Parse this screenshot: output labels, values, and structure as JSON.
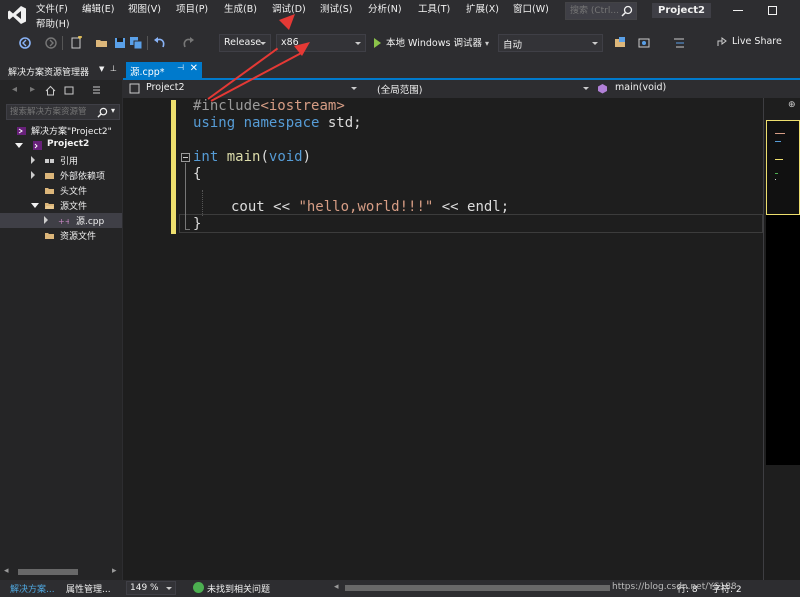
{
  "menu": {
    "items": [
      "文件(F)",
      "编辑(E)",
      "视图(V)",
      "项目(P)",
      "生成(B)",
      "调试(D)",
      "测试(S)",
      "分析(N)",
      "工具(T)",
      "扩展(X)",
      "窗口(W)"
    ],
    "help": "帮助(H)",
    "search_placeholder": "搜索 (Ctrl...",
    "project_title": "Project2"
  },
  "toolbar": {
    "configuration": "Release",
    "platform": "x86",
    "run_label": "本地 Windows 调试器",
    "auto_label": "自动",
    "live_share": "Live Share"
  },
  "solution_explorer": {
    "title": "解决方案资源管理器",
    "search_placeholder": "搜索解决方案资源管",
    "tree": [
      {
        "label": "解决方案\"Project2\"",
        "icon": "solution-icon"
      },
      {
        "label": "Project2",
        "icon": "project-icon"
      },
      {
        "label": "引用",
        "icon": "references-icon"
      },
      {
        "label": "外部依赖项",
        "icon": "dependencies-icon"
      },
      {
        "label": "头文件",
        "icon": "folder-icon"
      },
      {
        "label": "源文件",
        "icon": "folder-open-icon"
      },
      {
        "label": "源.cpp",
        "icon": "cpp-file-icon"
      },
      {
        "label": "资源文件",
        "icon": "folder-icon"
      }
    ]
  },
  "editor": {
    "tab_label": "源.cpp*",
    "nav_project": "Project2",
    "nav_scope": "(全局范围)",
    "nav_member": "main(void)",
    "code": {
      "include_directive": "#include",
      "include_open": "<",
      "include_header": "iostream",
      "include_close": ">",
      "using_kw": "using",
      "namespace_kw": "namespace",
      "namespace_name": " std;",
      "int_kw": "int",
      "main_name": "main",
      "paren_open": "(",
      "void_kw": "void",
      "paren_close": ")",
      "brace_open": "{",
      "cout_prefix": "cout << ",
      "string_literal": "\"hello,world!!!\"",
      "cout_suffix": " << endl;",
      "brace_close": "}"
    }
  },
  "status": {
    "zoom": "149 %",
    "issues": "未找到相关问题",
    "tab_solution": "解决方案...",
    "tab_properties": "属性管理...",
    "line": "行: 8",
    "char": "字符: 2",
    "watermark": "https://blog.csdn.net/YS188"
  },
  "colors": {
    "accent": "#007acc",
    "keyword": "#569cd6",
    "string": "#d69d85",
    "annotation": "#e53935",
    "modified_bar": "#eedf6e"
  }
}
